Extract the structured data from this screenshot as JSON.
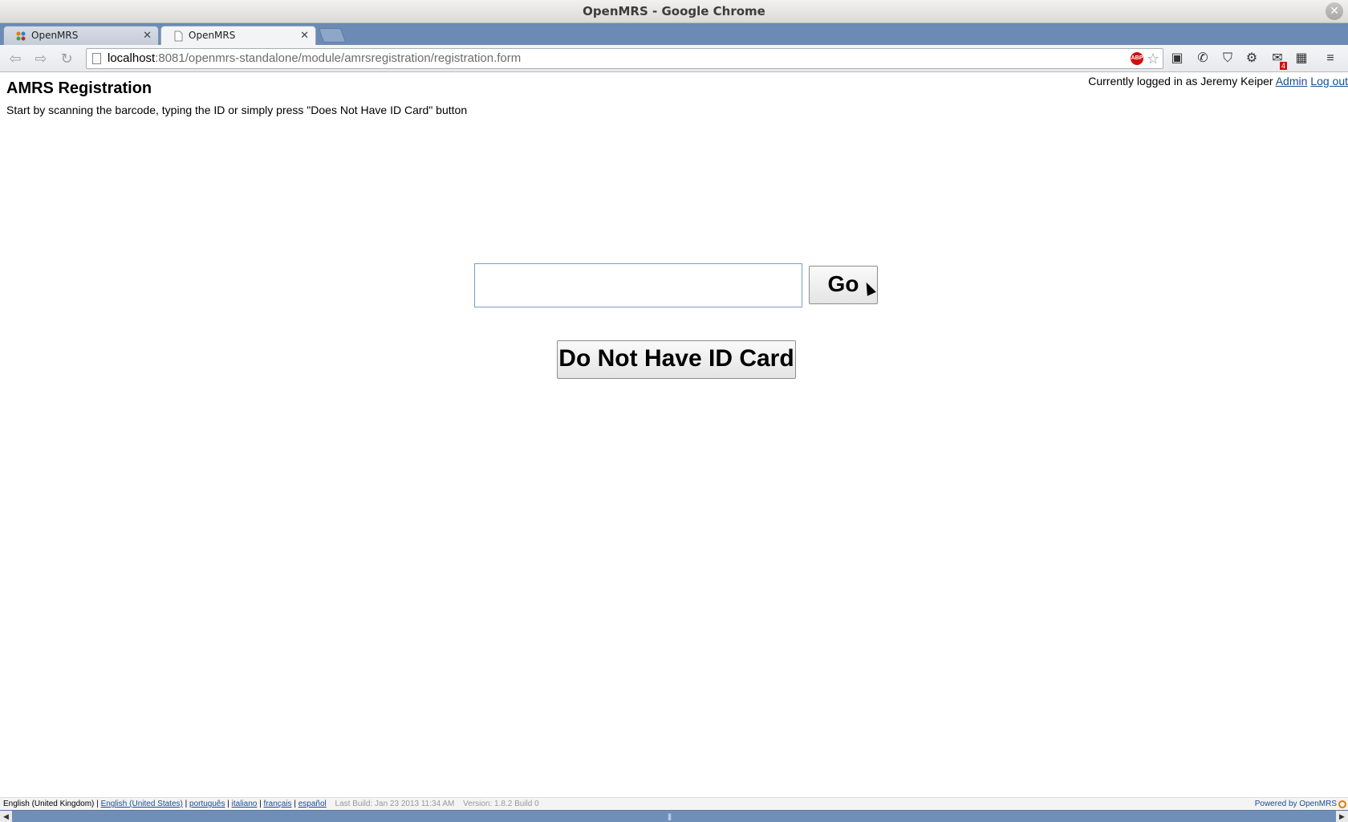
{
  "window": {
    "title": "OpenMRS - Google Chrome"
  },
  "tabs": [
    {
      "label": "OpenMRS"
    },
    {
      "label": "OpenMRS"
    }
  ],
  "toolbar": {
    "url_host": "localhost",
    "url_rest": ":8081/openmrs-standalone/module/amrsregistration/registration.form",
    "abp_label": "ABP",
    "extension_badge": "4"
  },
  "header": {
    "logged_in_text": "Currently logged in as Jeremy Keiper",
    "admin_link": "Admin",
    "logout_link": "Log out"
  },
  "main": {
    "title": "AMRS Registration",
    "instructions": "Start by scanning the barcode, typing the ID or simply press \"Does Not Have ID Card\" button",
    "id_input_value": "",
    "go_label": "Go",
    "no_id_label": "Do Not Have ID Card"
  },
  "footer": {
    "current_locale": "English (United Kingdom)",
    "separator": "|",
    "locales": [
      "English (United States)",
      "português",
      "italiano",
      "français",
      "español"
    ],
    "build": "Last Build: Jan 23 2013 11:34 AM",
    "version": "Version: 1.8.2 Build 0",
    "powered": "Powered by OpenMRS"
  }
}
